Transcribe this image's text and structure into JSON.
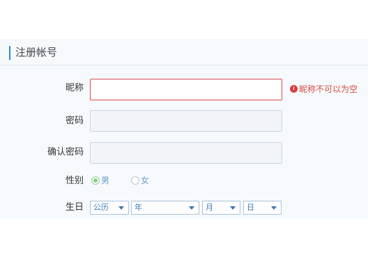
{
  "form": {
    "title": "注册帐号",
    "nickname": {
      "label": "昵称",
      "value": "",
      "error": "昵称不可以为空"
    },
    "password": {
      "label": "密码",
      "value": ""
    },
    "confirm_password": {
      "label": "确认密码",
      "value": ""
    },
    "gender": {
      "label": "性别",
      "options": [
        "男",
        "女"
      ],
      "selected": "男"
    },
    "birthday": {
      "label": "生日",
      "calendar": "公历",
      "year": "年",
      "month": "月",
      "day": "日"
    }
  },
  "colors": {
    "accent": "#2a84d2",
    "error": "#d8494c",
    "radio_checked": "#7fcf7f"
  },
  "icons": {
    "error": "error-icon",
    "select_caret": "chevron-down-icon"
  }
}
